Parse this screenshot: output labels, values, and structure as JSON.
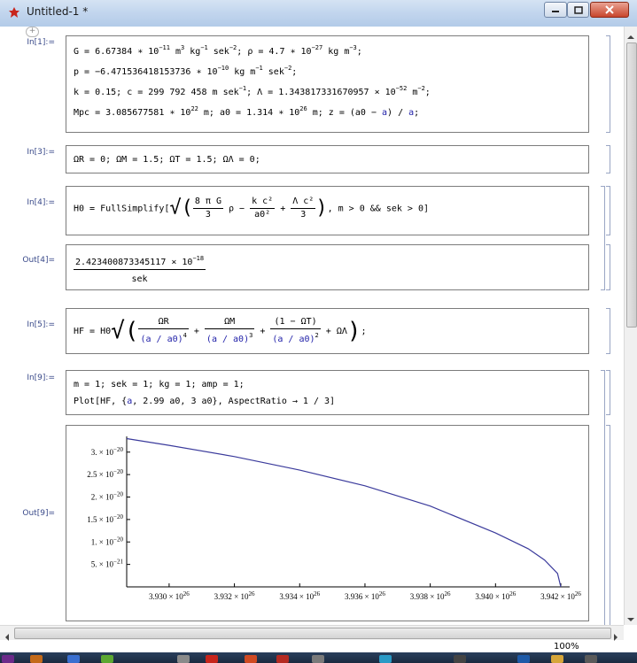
{
  "window": {
    "title": "Untitled-1 *"
  },
  "cells": [
    {
      "label": "In[1]:=",
      "line1": {
        "G": "G = 6.67384 ∗ 10",
        "G_exp": "−11",
        "G_unit": " m",
        "G_unit_exp": "3",
        "G_unit2": " kg",
        "G_unit2_exp": "−1",
        "G_unit3": " sek",
        "G_unit3_exp": "−2",
        "rho": "; ρ = 4.7 ∗ 10",
        "rho_exp": "−27",
        "rho_unit": " kg m",
        "rho_unit_exp": "−3",
        "end": ";"
      },
      "line2": {
        "p": "p = −6.471536418153736 ∗ 10",
        "p_exp": "−10",
        "p_unit": " kg m",
        "p_unit_exp": "−1",
        "p_unit2": " sek",
        "p_unit2_exp": "−2",
        "end": ";"
      },
      "line3": {
        "k": "k = 0.15; c = 299 792 458 m sek",
        "k_exp": "−1",
        "lam": "; Λ = 1.343817331670957 × 10",
        "lam_exp": "−52",
        "lam_unit": " m",
        "lam_unit_exp": "−2",
        "end": ";"
      },
      "line4": {
        "mpc": "Mpc = 3.085677581 ∗ 10",
        "mpc_exp": "22",
        "a0": " m; a0 = 1.314 ∗ 10",
        "a0_exp": "26",
        "z1": " m; z = (a0 − ",
        "a": "a",
        "z2": ") / ",
        "a2": "a",
        "end": ";"
      }
    },
    {
      "label": "In[3]:=",
      "code": "ΩR = 0; ΩM = 1.5; ΩT = 1.5; ΩΛ = 0;"
    },
    {
      "label": "In[4]:=",
      "pre": "H0 = FullSimplify[",
      "t1_num": "8 π G",
      "t1_den": "3",
      "rho": " ρ − ",
      "t2_num": "k c²",
      "t2_den": "a0²",
      "plus": " + ",
      "t3_num": "Λ c²",
      "t3_den": "3",
      "post": ", m > 0 && sek > 0]"
    },
    {
      "label": "Out[4]=",
      "num": "2.423400873345117 × 10",
      "num_exp": "−18",
      "den": "sek"
    },
    {
      "label": "In[5]:=",
      "pre": "HF = H0",
      "f1_num": "ΩR",
      "f1_den": "(a / a0)",
      "f1_exp": "4",
      "f2_num": "ΩM",
      "f2_den": "(a / a0)",
      "f2_exp": "3",
      "f3_num": "(1 − ΩT)",
      "f3_den": "(a / a0)",
      "f3_exp": "2",
      "tail": " + ΩΛ",
      "end": ";"
    },
    {
      "label": "In[9]:=",
      "line1": "m = 1; sek = 1; kg = 1; amp = 1;",
      "line2_pre": "Plot[HF, {",
      "line2_a": "a",
      "line2_post": ", 2.99 a0, 3 a0}, AspectRatio → 1 / 3]"
    },
    {
      "label": "Out[9]="
    }
  ],
  "chart_data": {
    "type": "line",
    "title": "",
    "xlabel": "",
    "ylabel": "",
    "xlim": [
      3.9287e+26,
      3.942e+26
    ],
    "ylim": [
      0,
      3.35e-20
    ],
    "x_ticks": [
      {
        "value": 3.93e+26,
        "mant": "3.930 × 10",
        "exp": "26"
      },
      {
        "value": 3.932e+26,
        "mant": "3.932 × 10",
        "exp": "26"
      },
      {
        "value": 3.934e+26,
        "mant": "3.934 × 10",
        "exp": "26"
      },
      {
        "value": 3.936e+26,
        "mant": "3.936 × 10",
        "exp": "26"
      },
      {
        "value": 3.938e+26,
        "mant": "3.938 × 10",
        "exp": "26"
      },
      {
        "value": 3.94e+26,
        "mant": "3.940 × 10",
        "exp": "26"
      },
      {
        "value": 3.942e+26,
        "mant": "3.942 × 10",
        "exp": "26"
      }
    ],
    "y_ticks": [
      {
        "value": 5e-21,
        "mant": "5. × 10",
        "exp": "−21"
      },
      {
        "value": 1e-20,
        "mant": "1. × 10",
        "exp": "−20"
      },
      {
        "value": 1.5e-20,
        "mant": "1.5 × 10",
        "exp": "−20"
      },
      {
        "value": 2e-20,
        "mant": "2. × 10",
        "exp": "−20"
      },
      {
        "value": 2.5e-20,
        "mant": "2.5 × 10",
        "exp": "−20"
      },
      {
        "value": 3e-20,
        "mant": "3. × 10",
        "exp": "−20"
      }
    ],
    "series": [
      {
        "color": "#3b3b9c",
        "x": [
          3.9287e+26,
          3.93e+26,
          3.932e+26,
          3.934e+26,
          3.936e+26,
          3.938e+26,
          3.94e+26,
          3.941e+26,
          3.9415e+26,
          3.9419e+26,
          3.942e+26
        ],
        "y": [
          3.3e-20,
          3.15e-20,
          2.9e-20,
          2.6e-20,
          2.25e-20,
          1.8e-20,
          1.2e-20,
          8.5e-21,
          6e-21,
          3e-21,
          0.0
        ]
      }
    ],
    "grid": false
  },
  "status": {
    "zoom": "100%"
  },
  "colors": {
    "label": "#3a4a8a",
    "symbol": "#1f1fa8",
    "curve": "#3b3b9c"
  }
}
